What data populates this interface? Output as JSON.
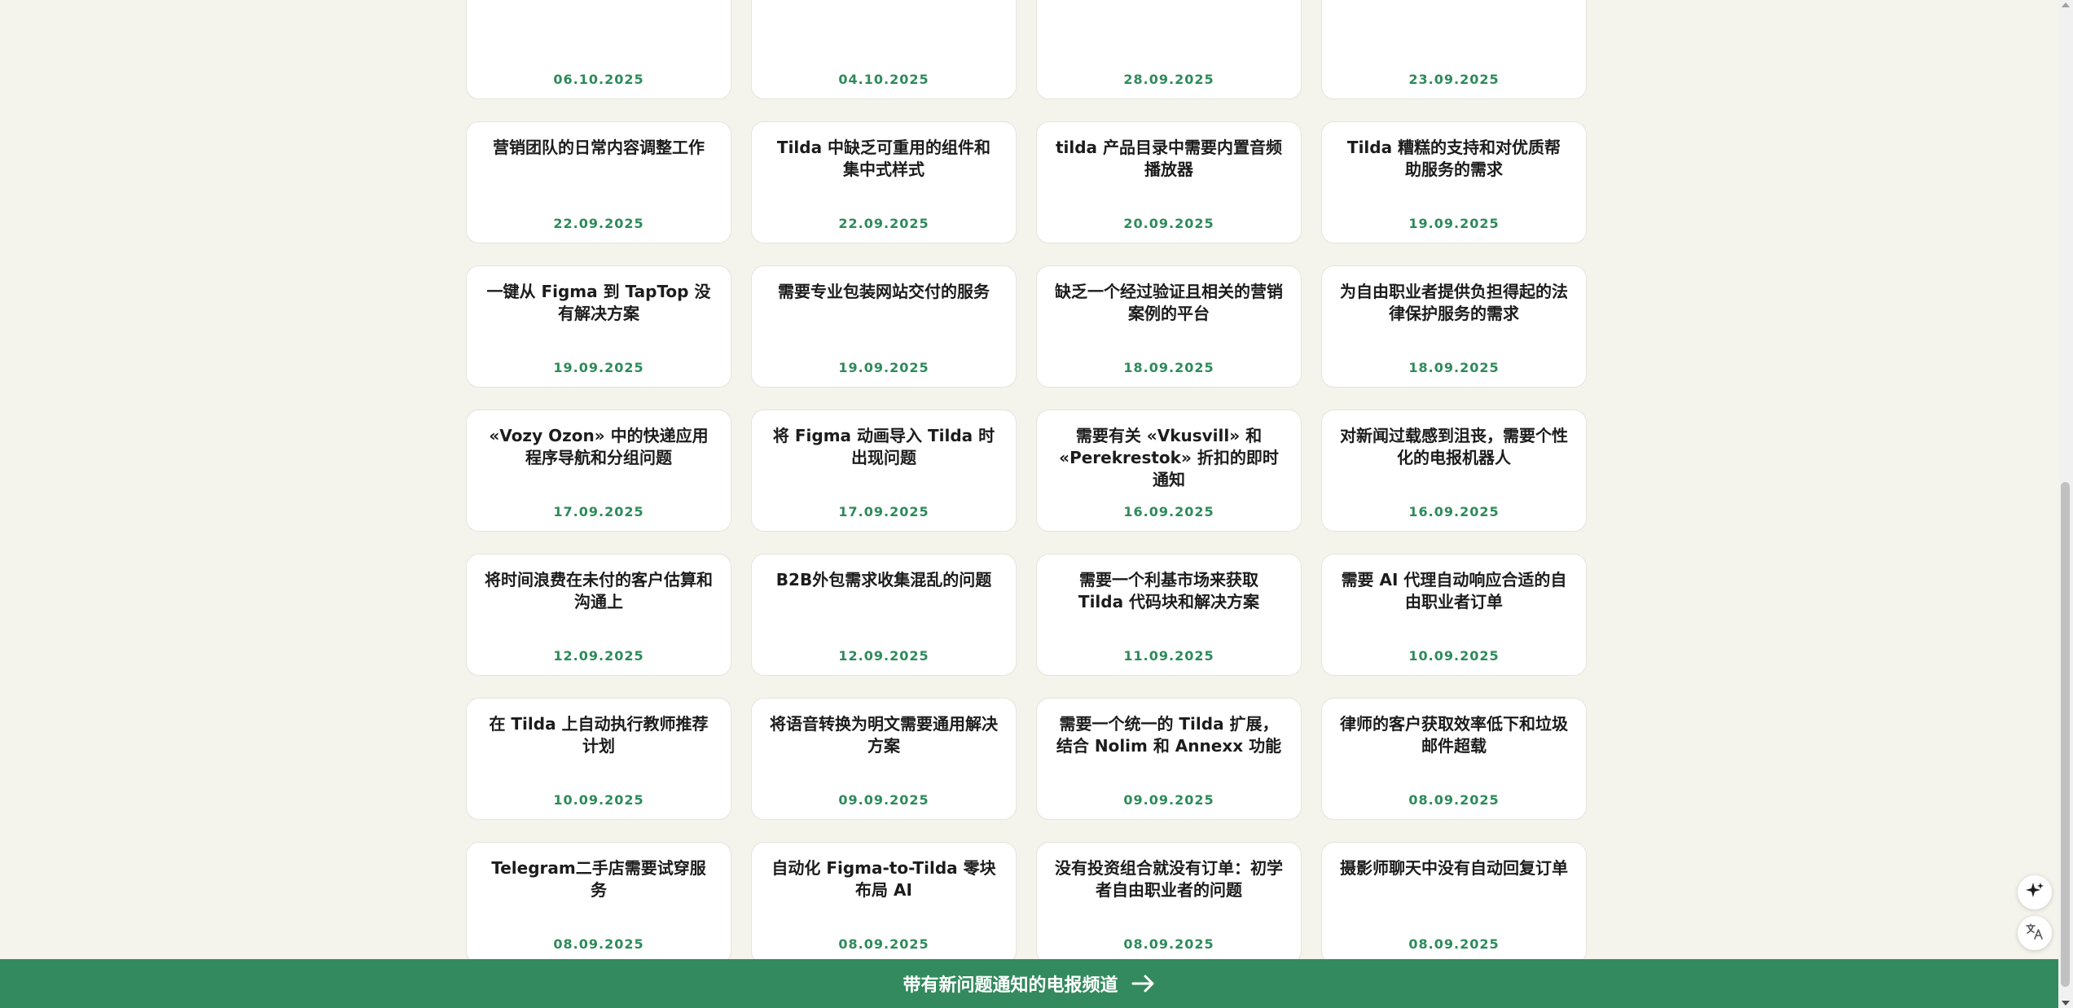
{
  "cards": [
    {
      "title": "",
      "date": "06.10.2025"
    },
    {
      "title": "",
      "date": "04.10.2025"
    },
    {
      "title": "",
      "date": "28.09.2025"
    },
    {
      "title": "",
      "date": "23.09.2025"
    },
    {
      "title": "营销团队的日常内容调整工作",
      "date": "22.09.2025"
    },
    {
      "title": "Tilda 中缺乏可重用的组件和集中式样式",
      "date": "22.09.2025"
    },
    {
      "title": "tilda 产品目录中需要内置音频播放器",
      "date": "20.09.2025"
    },
    {
      "title": "Tilda 糟糕的支持和对优质帮助服务的需求",
      "date": "19.09.2025"
    },
    {
      "title": "一键从 Figma 到 TapTop 没有解决方案",
      "date": "19.09.2025"
    },
    {
      "title": "需要专业包装网站交付的服务",
      "date": "19.09.2025"
    },
    {
      "title": "缺乏一个经过验证且相关的营销案例的平台",
      "date": "18.09.2025"
    },
    {
      "title": "为自由职业者提供负担得起的法律保护服务的需求",
      "date": "18.09.2025"
    },
    {
      "title": "«Vozy Ozon» 中的快递应用程序导航和分组问题",
      "date": "17.09.2025"
    },
    {
      "title": "将 Figma 动画导入 Tilda 时出现问题",
      "date": "17.09.2025"
    },
    {
      "title": "需要有关 «Vkusvill» 和 «Perekrestok» 折扣的即时通知",
      "date": "16.09.2025"
    },
    {
      "title": "对新闻过载感到沮丧，需要个性化的电报机器人",
      "date": "16.09.2025"
    },
    {
      "title": "将时间浪费在未付的客户估算和沟通上",
      "date": "12.09.2025"
    },
    {
      "title": "B2B外包需求收集混乱的问题",
      "date": "12.09.2025"
    },
    {
      "title": "需要一个利基市场来获取 Tilda 代码块和解决方案",
      "date": "11.09.2025"
    },
    {
      "title": "需要 AI 代理自动响应合适的自由职业者订单",
      "date": "10.09.2025"
    },
    {
      "title": "在 Tilda 上自动执行教师推荐计划",
      "date": "10.09.2025"
    },
    {
      "title": "将语音转换为明文需要通用解决方案",
      "date": "09.09.2025"
    },
    {
      "title": "需要一个统一的 Tilda 扩展，结合 Nolim 和 Annexx 功能",
      "date": "09.09.2025"
    },
    {
      "title": "律师的客户获取效率低下和垃圾邮件超载",
      "date": "08.09.2025"
    },
    {
      "title": "Telegram二手店需要试穿服务",
      "date": "08.09.2025"
    },
    {
      "title": "自动化 Figma-to-Tilda 零块布局 AI",
      "date": "08.09.2025"
    },
    {
      "title": "没有投资组合就没有订单：初学者自由职业者的问题",
      "date": "08.09.2025"
    },
    {
      "title": "摄影师聊天中没有自动回复订单",
      "date": "08.09.2025"
    }
  ],
  "footer": {
    "label": "带有新问题通知的电报频道",
    "arrow_icon": "arrow-right-icon"
  },
  "floating": {
    "ai_icon": "sparkle-icon",
    "translate_icon": "translate-icon"
  },
  "colors": {
    "background": "#f4f3ec",
    "accent": "#338a5e",
    "date_text": "#2e8a5a",
    "card": "#ffffff"
  }
}
